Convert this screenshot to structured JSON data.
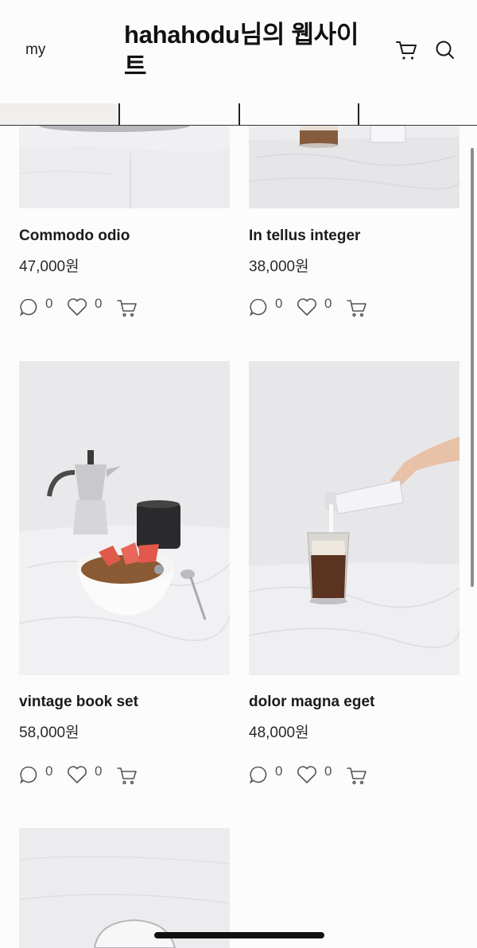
{
  "header": {
    "my_label": "my",
    "site_title": "hahahodu님의 웹사이트",
    "cart_icon": "cart-icon",
    "search_icon": "search-icon"
  },
  "tabs": {
    "count": 4
  },
  "products": [
    {
      "name": "Commodo odio",
      "price": "47,000원",
      "comments": "0",
      "likes": "0"
    },
    {
      "name": "In tellus integer",
      "price": "38,000원",
      "comments": "0",
      "likes": "0"
    },
    {
      "name": "vintage book set",
      "price": "58,000원",
      "comments": "0",
      "likes": "0"
    },
    {
      "name": "dolor magna eget",
      "price": "48,000원",
      "comments": "0",
      "likes": "0"
    }
  ],
  "icons": {
    "comment": "comment-icon",
    "like": "heart-icon",
    "add_to_cart": "cart-icon"
  },
  "colors": {
    "background": "#fdfcfd",
    "text": "#1a1a1a",
    "icon": "#555555"
  }
}
